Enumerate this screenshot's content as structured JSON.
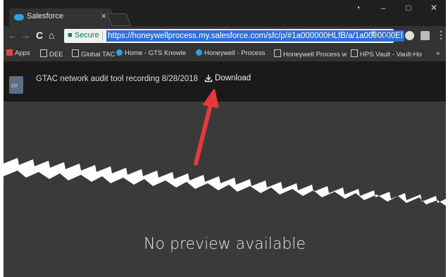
{
  "browser": {
    "tab_title": "Salesforce",
    "tab_close": "×",
    "window_controls": {
      "user": "◔",
      "minimize": "–",
      "maximize": "□",
      "close": "✕"
    },
    "nav": {
      "back": "←",
      "forward": "→",
      "reload": "C",
      "home": "⌂"
    },
    "address": {
      "secure_label": "Secure",
      "url": "https://honeywellprocess.my.salesforce.com/sfc/p/#1a000000HLfB/a/1a0000000El",
      "icons": "🔍 ☆"
    },
    "bookmarks": [
      {
        "label": "Apps",
        "icon": "apps-icon"
      },
      {
        "label": "DEE",
        "icon": "page-icon"
      },
      {
        "label": "Global TAC",
        "icon": "page-icon"
      },
      {
        "label": "Home - GTS Knowle",
        "icon": "salesforce-icon"
      },
      {
        "label": "Honeywell - Process",
        "icon": "salesforce-icon"
      },
      {
        "label": "Honeywell Process w",
        "icon": "page-icon"
      },
      {
        "label": "HPS Vault - Vault-Ho",
        "icon": "page-icon"
      }
    ],
    "more": "»"
  },
  "file": {
    "type_badge": "ZIP",
    "name": "GTAC network audit tool recording 8/28/2018",
    "download_label": "Download"
  },
  "preview": {
    "message": "No preview available"
  },
  "colors": {
    "annotation_arrow": "#e8383b",
    "url_highlight": "#2e6fd6",
    "preview_bg": "#3a3a3a"
  }
}
